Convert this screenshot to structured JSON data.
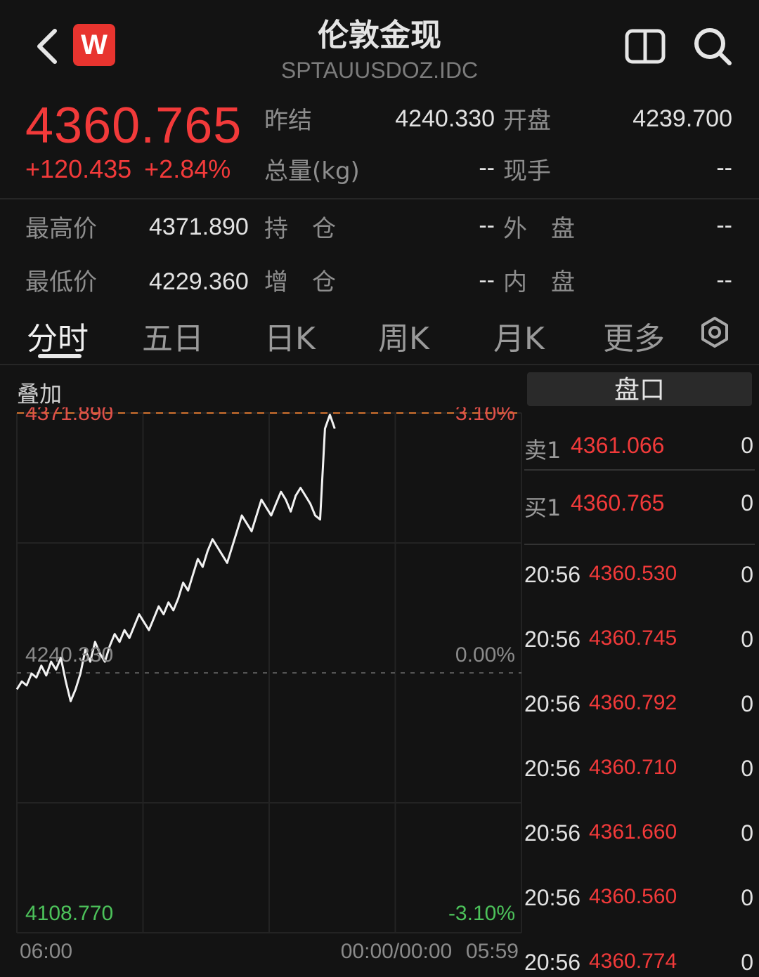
{
  "header": {
    "title": "伦敦金现",
    "code": "SPTAUUSDOZ.IDC",
    "logo_letter": "W"
  },
  "quote": {
    "price": "4360.765",
    "change": "+120.435",
    "change_pct": "+2.84%",
    "fields": {
      "prev_close_label": "昨结",
      "prev_close": "4240.330",
      "open_label": "开盘",
      "open": "4239.700",
      "volume_label": "总量(kg)",
      "volume": "--",
      "current_hand_label": "现手",
      "current_hand": "--",
      "high_label": "最高价",
      "high": "4371.890",
      "position_label": "持　仓",
      "position": "--",
      "outer_label": "外　盘",
      "outer": "--",
      "low_label": "最低价",
      "low": "4229.360",
      "pos_change_label": "增　仓",
      "pos_change": "--",
      "inner_label": "内　盘",
      "inner": "--"
    }
  },
  "tabs": [
    {
      "label": "分时",
      "active": true
    },
    {
      "label": "五日",
      "active": false
    },
    {
      "label": "日K",
      "active": false
    },
    {
      "label": "周K",
      "active": false
    },
    {
      "label": "月K",
      "active": false
    },
    {
      "label": "更多",
      "active": false
    }
  ],
  "overlay_label": "叠加",
  "chart_data": {
    "type": "line",
    "y_top_label": "4371.890",
    "y_mid_label": "4240.330",
    "y_bottom_label": "4108.770",
    "pct_top_label": "3.10%",
    "pct_mid_label": "0.00%",
    "pct_bottom_label": "-3.10%",
    "x_labels": [
      "06:00",
      "00:00/00:00",
      "05:59"
    ],
    "ylim": [
      4108.77,
      4371.89
    ],
    "prev_close": 4240.33,
    "high": 4371.89,
    "series": [
      {
        "values": [
          4232,
          4236,
          4234,
          4240,
          4238,
          4244,
          4239,
          4246,
          4242,
          4248,
          4236,
          4226,
          4232,
          4240,
          4252,
          4246,
          4256,
          4250,
          4246,
          4254,
          4260,
          4256,
          4262,
          4258,
          4264,
          4270,
          4266,
          4262,
          4268,
          4274,
          4270,
          4276,
          4272,
          4278,
          4286,
          4282,
          4290,
          4298,
          4294,
          4302,
          4308,
          4304,
          4300,
          4296,
          4304,
          4312,
          4320,
          4316,
          4312,
          4320,
          4328,
          4324,
          4320,
          4326,
          4332,
          4328,
          4322,
          4330,
          4334,
          4330,
          4326,
          4320,
          4318,
          4364,
          4371,
          4364
        ]
      }
    ],
    "grid": true,
    "line_color": "#f2f2f2",
    "prev_close_line_color": "#555555",
    "high_line_color": "#d2722f"
  },
  "order_book": {
    "header": "盘口",
    "rows": [
      {
        "label": "卖1",
        "price": "4361.066",
        "volume": "0"
      },
      {
        "label": "买1",
        "price": "4360.765",
        "volume": "0"
      }
    ],
    "ticks": [
      {
        "time": "20:56",
        "price": "4360.530",
        "volume": "0"
      },
      {
        "time": "20:56",
        "price": "4360.745",
        "volume": "0"
      },
      {
        "time": "20:56",
        "price": "4360.792",
        "volume": "0"
      },
      {
        "time": "20:56",
        "price": "4360.710",
        "volume": "0"
      },
      {
        "time": "20:56",
        "price": "4361.660",
        "volume": "0"
      },
      {
        "time": "20:56",
        "price": "4360.560",
        "volume": "0"
      },
      {
        "time": "20:56",
        "price": "4360.774",
        "volume": "0"
      }
    ]
  },
  "colors": {
    "up": "#f23a3a",
    "down": "#2fb84a",
    "background": "#131313"
  }
}
